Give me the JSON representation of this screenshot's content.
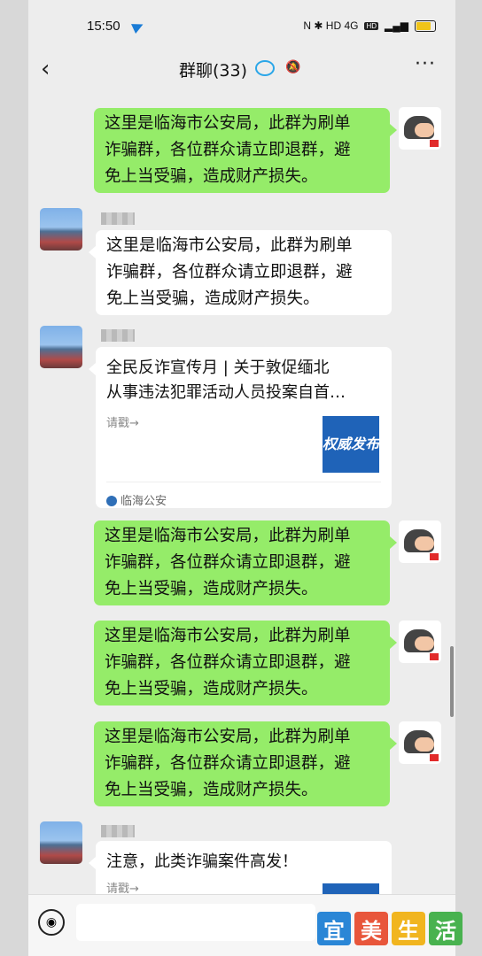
{
  "status": {
    "time": "15:50",
    "icons_text": "N ✱ HD 4G"
  },
  "nav": {
    "back": "‹",
    "title": "群聊(33)",
    "more": "···"
  },
  "messages": [
    {
      "side": "right",
      "lines": [
        "这里是临海市公安局，此群为刷单",
        "诈骗群，各位群众请立即退群，避",
        "免上当受骗，造成财产损失。"
      ]
    },
    {
      "side": "left",
      "lines": [
        "这里是临海市公安局，此群为刷单",
        "诈骗群，各位群众请立即退群，避",
        "免上当受骗，造成财产损失。"
      ]
    },
    {
      "side": "left",
      "card": true,
      "title_lines": [
        "全民反诈宣传月 | 关于敦促缅北",
        "从事违法犯罪活动人员投案自首…"
      ],
      "sub": "请戳→",
      "thumb": "权威发布",
      "source": "临海公安"
    },
    {
      "side": "right",
      "lines": [
        "这里是临海市公安局，此群为刷单",
        "诈骗群，各位群众请立即退群，避",
        "免上当受骗，造成财产损失。"
      ]
    },
    {
      "side": "right",
      "lines": [
        "这里是临海市公安局，此群为刷单",
        "诈骗群，各位群众请立即退群，避",
        "免上当受骗，造成财产损失。"
      ]
    },
    {
      "side": "right",
      "lines": [
        "这里是临海市公安局，此群为刷单",
        "诈骗群，各位群众请立即退群，避",
        "免上当受骗，造成财产损失。"
      ]
    },
    {
      "side": "left",
      "card": true,
      "partial": true,
      "title_lines": [
        "注意，此类诈骗案件高发！"
      ],
      "sub": "请戳→"
    }
  ],
  "watermark": [
    "宜",
    "美",
    "生",
    "活"
  ],
  "colors": {
    "green_bubble": "#95ec69",
    "background": "#ededed",
    "accent": "#2aa6e8"
  }
}
